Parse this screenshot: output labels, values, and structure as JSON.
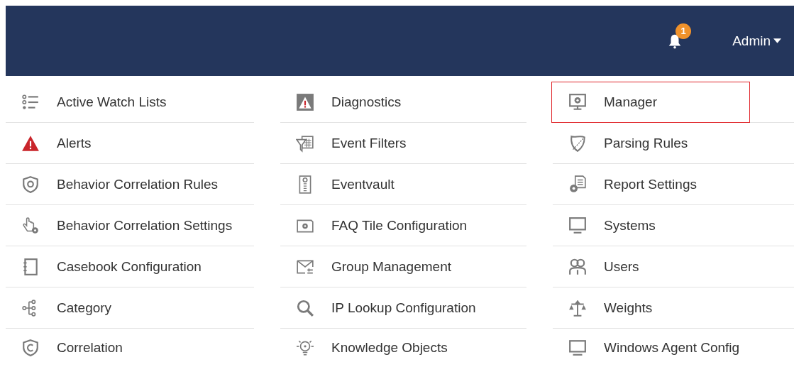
{
  "header": {
    "notification_count": "1",
    "user_menu": "Admin"
  },
  "columns": [
    {
      "items": [
        {
          "label": "Active Watch Lists",
          "selected": false
        },
        {
          "label": "Alerts",
          "selected": false
        },
        {
          "label": "Behavior Correlation Rules",
          "selected": false
        },
        {
          "label": "Behavior Correlation Settings",
          "selected": false
        },
        {
          "label": "Casebook Configuration",
          "selected": false
        },
        {
          "label": "Category",
          "selected": false
        },
        {
          "label": "Correlation",
          "selected": false
        }
      ]
    },
    {
      "items": [
        {
          "label": "Diagnostics",
          "selected": false
        },
        {
          "label": "Event Filters",
          "selected": false
        },
        {
          "label": "Eventvault",
          "selected": false
        },
        {
          "label": "FAQ Tile Configuration",
          "selected": false
        },
        {
          "label": "Group Management",
          "selected": false
        },
        {
          "label": "IP Lookup Configuration",
          "selected": false
        },
        {
          "label": "Knowledge Objects",
          "selected": false
        }
      ]
    },
    {
      "items": [
        {
          "label": "Manager",
          "selected": true
        },
        {
          "label": "Parsing Rules",
          "selected": false
        },
        {
          "label": "Report Settings",
          "selected": false
        },
        {
          "label": "Systems",
          "selected": false
        },
        {
          "label": "Users",
          "selected": false
        },
        {
          "label": "Weights",
          "selected": false
        },
        {
          "label": "Windows Agent Config",
          "selected": false
        }
      ]
    }
  ]
}
